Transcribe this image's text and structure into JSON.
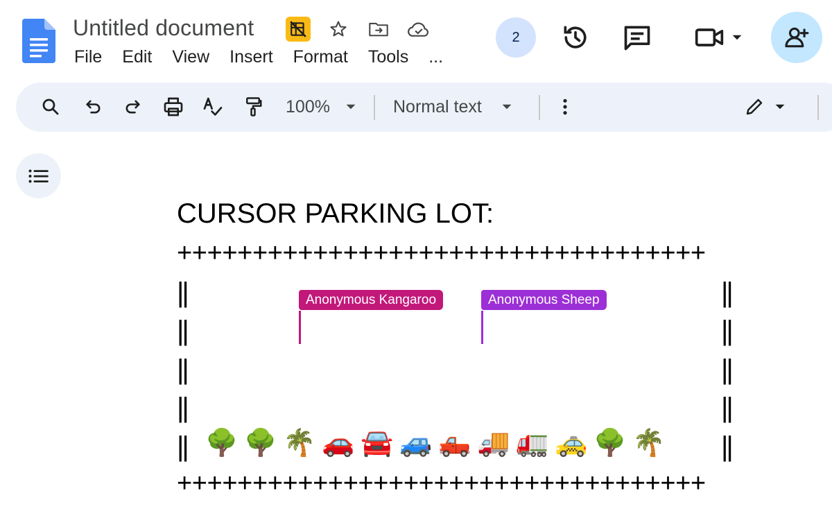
{
  "app": {
    "doc_title": "Untitled document",
    "viewer_count": "2"
  },
  "menu": [
    "File",
    "Edit",
    "View",
    "Insert",
    "Format",
    "Tools",
    "..."
  ],
  "toolbar": {
    "zoom": "100%",
    "style": "Normal text"
  },
  "document": {
    "heading": "CURSOR PARKING LOT:",
    "top_border": "+++++++++++++++++++++++++++++++++++",
    "bottom_border": "+++++++++++++++++++++++++++++++++++",
    "wall": "||",
    "cursors": [
      {
        "name": "Anonymous Kangaroo",
        "color": "#c2187a"
      },
      {
        "name": "Anonymous Sheep",
        "color": "#9c2fd6"
      }
    ],
    "parking_row": [
      "🌳",
      "🌳",
      "🌴",
      "🚗",
      "🚘",
      "🚙",
      "🛻",
      "🚚",
      "🚛",
      "🚕",
      "🌳",
      "🌴"
    ],
    "parking_icon_names": [
      "tree-icon",
      "tree-icon",
      "palm-tree-icon",
      "red-car-icon",
      "oncoming-car-icon",
      "suv-icon",
      "pickup-truck-icon",
      "delivery-truck-icon",
      "lorry-icon",
      "taxi-icon",
      "tree-icon",
      "palm-tree-icon"
    ]
  },
  "colors": {
    "docs_blue": "#4285f4",
    "toolbar_bg": "#edf2fa",
    "share_bg": "#c2e7ff",
    "viewer_bg": "#d3e3fd",
    "badge_yellow": "#f9ba15"
  }
}
